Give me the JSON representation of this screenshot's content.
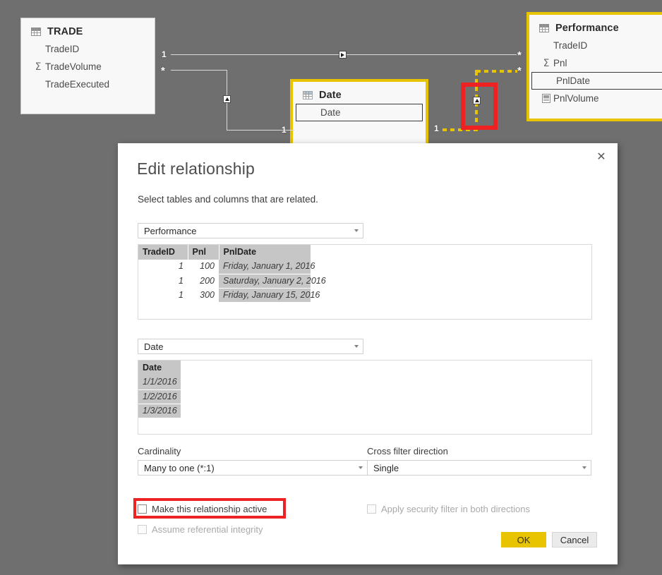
{
  "canvas": {
    "tables": [
      {
        "name": "TRADE",
        "icon": "table-icon",
        "selected": false,
        "fields": [
          {
            "label": "TradeID",
            "glyph": "none"
          },
          {
            "label": "TradeVolume",
            "glyph": "sigma-icon"
          },
          {
            "label": "TradeExecuted",
            "glyph": "none"
          }
        ]
      },
      {
        "name": "Date",
        "icon": "date-table-icon",
        "selected": true,
        "fields": [
          {
            "label": "Date",
            "glyph": "none",
            "highlighted": true
          }
        ]
      },
      {
        "name": "Performance",
        "icon": "table-icon",
        "selected": true,
        "fields": [
          {
            "label": "TradeID",
            "glyph": "none"
          },
          {
            "label": "Pnl",
            "glyph": "sigma-icon"
          },
          {
            "label": "PnlDate",
            "glyph": "none",
            "highlighted": true
          },
          {
            "label": "PnlVolume",
            "glyph": "calculator-icon"
          }
        ]
      }
    ],
    "cardinality_markers": [
      {
        "symbol": "1",
        "at": "trade-right-top"
      },
      {
        "symbol": "*",
        "at": "trade-right-bottom"
      },
      {
        "symbol": "1",
        "at": "date-left"
      },
      {
        "symbol": "1",
        "at": "date-right"
      },
      {
        "symbol": "*",
        "at": "performance-left-top"
      },
      {
        "symbol": "*",
        "at": "performance-left-bottom"
      }
    ],
    "relationships": [
      {
        "style": "solid",
        "state": "active",
        "arrow": "right"
      },
      {
        "style": "solid",
        "state": "active",
        "arrow": "up"
      },
      {
        "style": "dashed",
        "state": "inactive",
        "arrow": "up",
        "accent": "#e8c300"
      }
    ],
    "highlight_color": "#ee2222"
  },
  "dialog": {
    "title": "Edit relationship",
    "subtitle": "Select tables and columns that are related.",
    "close_label": "✕",
    "from": {
      "selected_table": "Performance",
      "columns": [
        "TradeID",
        "Pnl",
        "PnlDate"
      ],
      "rows": [
        [
          "1",
          "100",
          "Friday, January 1, 2016"
        ],
        [
          "1",
          "200",
          "Saturday, January 2, 2016"
        ],
        [
          "1",
          "300",
          "Friday, January 15, 2016"
        ]
      ]
    },
    "to": {
      "selected_table": "Date",
      "columns": [
        "Date"
      ],
      "rows": [
        [
          "1/1/2016"
        ],
        [
          "1/2/2016"
        ],
        [
          "1/3/2016"
        ]
      ]
    },
    "cardinality": {
      "label": "Cardinality",
      "value": "Many to one (*:1)"
    },
    "cross_filter": {
      "label": "Cross filter direction",
      "value": "Single"
    },
    "checkboxes": [
      {
        "label": "Make this relationship active",
        "checked": false,
        "disabled": false,
        "highlighted": true
      },
      {
        "label": "Apply security filter in both directions",
        "checked": false,
        "disabled": true,
        "highlighted": false
      },
      {
        "label": "Assume referential integrity",
        "checked": false,
        "disabled": true,
        "highlighted": false
      }
    ],
    "buttons": {
      "ok": "OK",
      "cancel": "Cancel"
    }
  }
}
